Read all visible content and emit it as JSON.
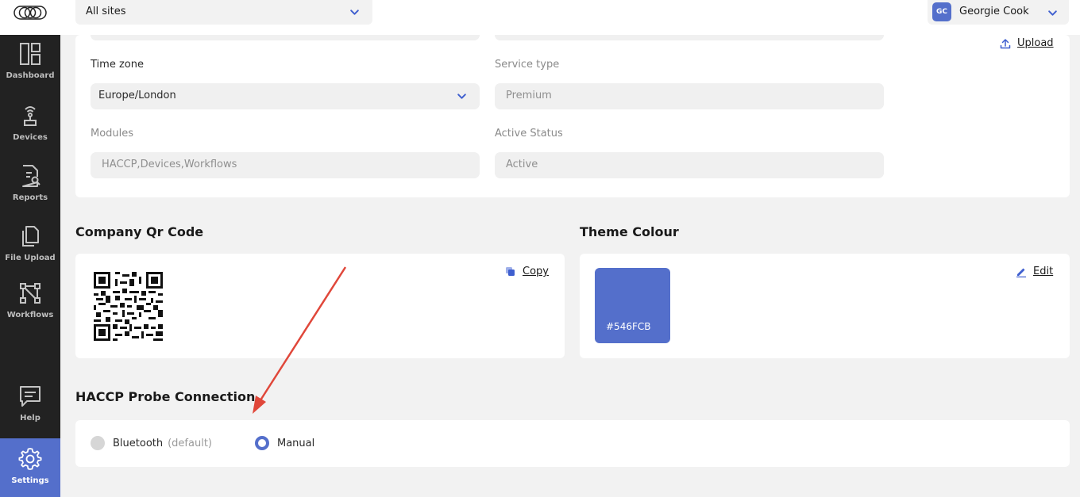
{
  "topbar": {
    "site_selector": "All sites",
    "user": {
      "initials": "GC",
      "name": "Georgie Cook"
    }
  },
  "sidebar": {
    "items": [
      {
        "label": "Dashboard",
        "icon": "dashboard-icon"
      },
      {
        "label": "Devices",
        "icon": "device-icon"
      },
      {
        "label": "Reports",
        "icon": "report-icon"
      },
      {
        "label": "File Upload",
        "icon": "file-upload-icon"
      },
      {
        "label": "Workflows",
        "icon": "workflow-icon"
      },
      {
        "label": "Help",
        "icon": "help-icon"
      },
      {
        "label": "Settings",
        "icon": "gear-icon",
        "active": true
      }
    ]
  },
  "company_details": {
    "upload_label": "Upload",
    "time_zone": {
      "label": "Time zone",
      "value": "Europe/London"
    },
    "service_type": {
      "label": "Service type",
      "value": "Premium"
    },
    "modules": {
      "label": "Modules",
      "value": "HACCP,Devices,Workflows"
    },
    "active_status": {
      "label": "Active Status",
      "value": "Active"
    }
  },
  "qr_section": {
    "title": "Company Qr Code",
    "copy_label": "Copy"
  },
  "theme_section": {
    "title": "Theme Colour",
    "edit_label": "Edit",
    "color_hex": "#546FCB"
  },
  "haccp_section": {
    "title": "HACCP Probe Connection",
    "options": [
      {
        "label": "Bluetooth",
        "hint": "(default)",
        "selected": false
      },
      {
        "label": "Manual",
        "selected": true
      }
    ]
  },
  "colors": {
    "accent": "#546FCB",
    "sidebar_bg": "#222222",
    "annotation_arrow": "#e0473a"
  }
}
